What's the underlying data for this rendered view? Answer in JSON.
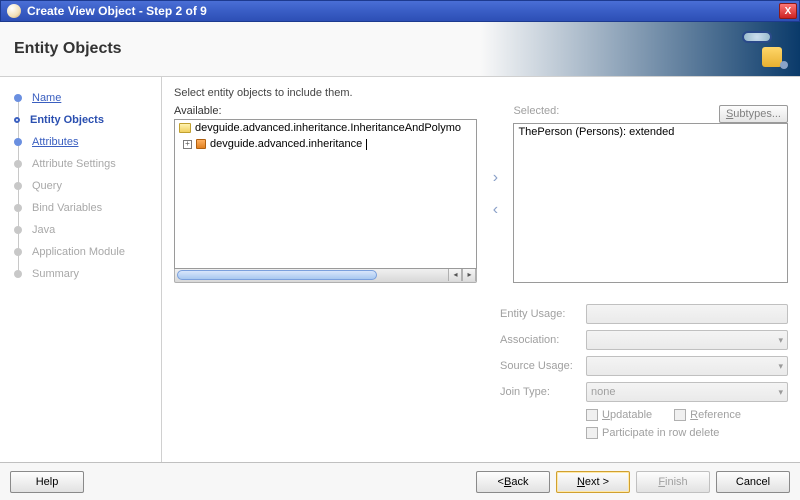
{
  "window": {
    "title": "Create View Object - Step 2 of 9",
    "close_glyph": "X"
  },
  "banner": {
    "heading": "Entity Objects"
  },
  "wizard_steps": [
    {
      "label": "Name",
      "state": "done"
    },
    {
      "label": "Entity Objects",
      "state": "current"
    },
    {
      "label": "Attributes",
      "state": "done"
    },
    {
      "label": "Attribute Settings",
      "state": "future"
    },
    {
      "label": "Query",
      "state": "future"
    },
    {
      "label": "Bind Variables",
      "state": "future"
    },
    {
      "label": "Java",
      "state": "future"
    },
    {
      "label": "Application Module",
      "state": "future"
    },
    {
      "label": "Summary",
      "state": "future"
    }
  ],
  "content": {
    "instruction": "Select entity objects to include them.",
    "available_label": "Available:",
    "available_items": [
      {
        "type": "package",
        "text": "devguide.advanced.inheritance.InheritanceAndPolymo",
        "has_children": false
      },
      {
        "type": "entity",
        "text": "devguide.advanced.inheritance",
        "has_children": true
      }
    ],
    "selected_label": "Selected:",
    "subtypes_label": "Subtypes...",
    "selected_items": [
      {
        "text": "ThePerson (Persons): extended"
      }
    ],
    "shuttle": {
      "add": "›",
      "remove": "‹"
    }
  },
  "form": {
    "entity_usage_label": "Entity Usage:",
    "association_label": "Association:",
    "source_usage_label": "Source Usage:",
    "join_type_label": "Join Type:",
    "join_type_value": "none",
    "updatable_label": "pdatable",
    "reference_label": "eference",
    "participate_label": "Participate in row delete"
  },
  "buttons": {
    "help": "Help",
    "back": "< Back",
    "next": "Next >",
    "finish": "Finish",
    "cancel": "Cancel"
  }
}
